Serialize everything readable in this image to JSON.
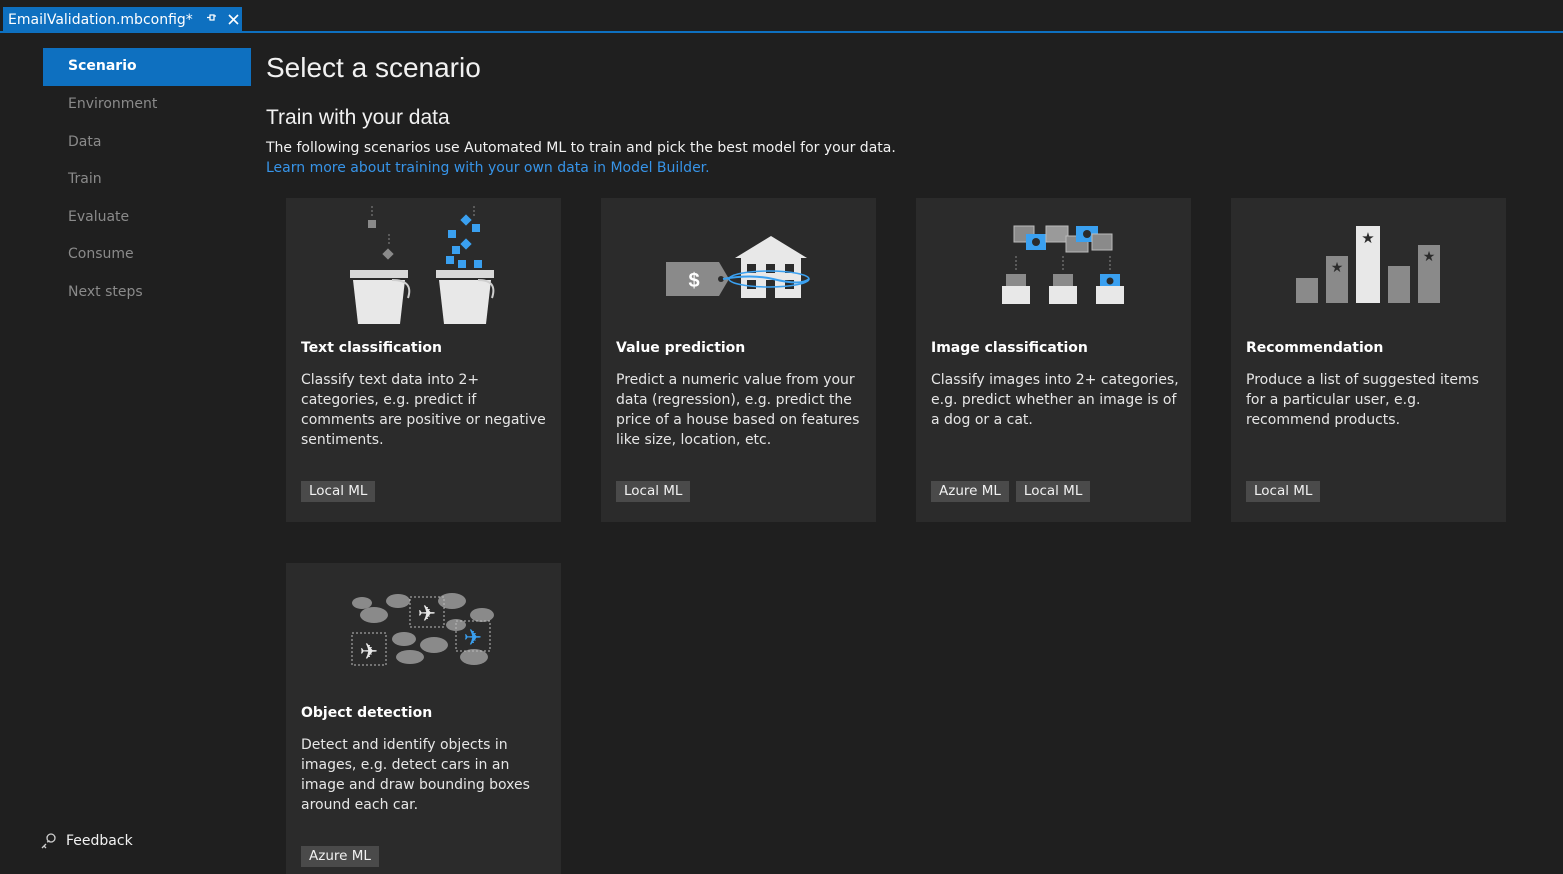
{
  "tab": {
    "title": "EmailValidation.mbconfig*",
    "pin_icon": "pin-icon",
    "close_icon": "close-icon"
  },
  "colors": {
    "accent": "#0e70c0",
    "link": "#3794e8",
    "card_bg": "#2b2b2b",
    "page_bg": "#1f1f1f",
    "icon_blue": "#3aa0f0"
  },
  "sidebar": {
    "items": [
      {
        "label": "Scenario",
        "active": true
      },
      {
        "label": "Environment"
      },
      {
        "label": "Data"
      },
      {
        "label": "Train"
      },
      {
        "label": "Evaluate"
      },
      {
        "label": "Consume"
      },
      {
        "label": "Next steps"
      }
    ],
    "feedback_label": "Feedback"
  },
  "main": {
    "title": "Select a scenario",
    "section_title": "Train with your data",
    "description": "The following scenarios use Automated ML to train and pick the best model for your data.",
    "learn_more": "Learn more about training with your own data in Model Builder."
  },
  "cards": [
    {
      "title": "Text classification",
      "description": "Classify text data into 2+ categories, e.g. predict if comments are positive or negative sentiments.",
      "tags": [
        "Local ML"
      ],
      "icon": "buckets-icon"
    },
    {
      "title": "Value prediction",
      "description": "Predict a numeric value from your data (regression), e.g. predict the price of a house based on features like size, location, etc.",
      "tags": [
        "Local ML"
      ],
      "icon": "house-price-icon"
    },
    {
      "title": "Image classification",
      "description": "Classify images into 2+ categories, e.g. predict whether an image is of a dog or a cat.",
      "tags": [
        "Azure ML",
        "Local ML"
      ],
      "icon": "image-sort-icon"
    },
    {
      "title": "Recommendation",
      "description": "Produce a list of suggested items for a particular user, e.g. recommend products.",
      "tags": [
        "Local ML"
      ],
      "icon": "star-bars-icon"
    },
    {
      "title": "Object detection",
      "description": "Detect and identify objects in images, e.g. detect cars in an image and draw bounding boxes around each car.",
      "tags": [
        "Azure ML"
      ],
      "icon": "planes-clouds-icon"
    }
  ]
}
